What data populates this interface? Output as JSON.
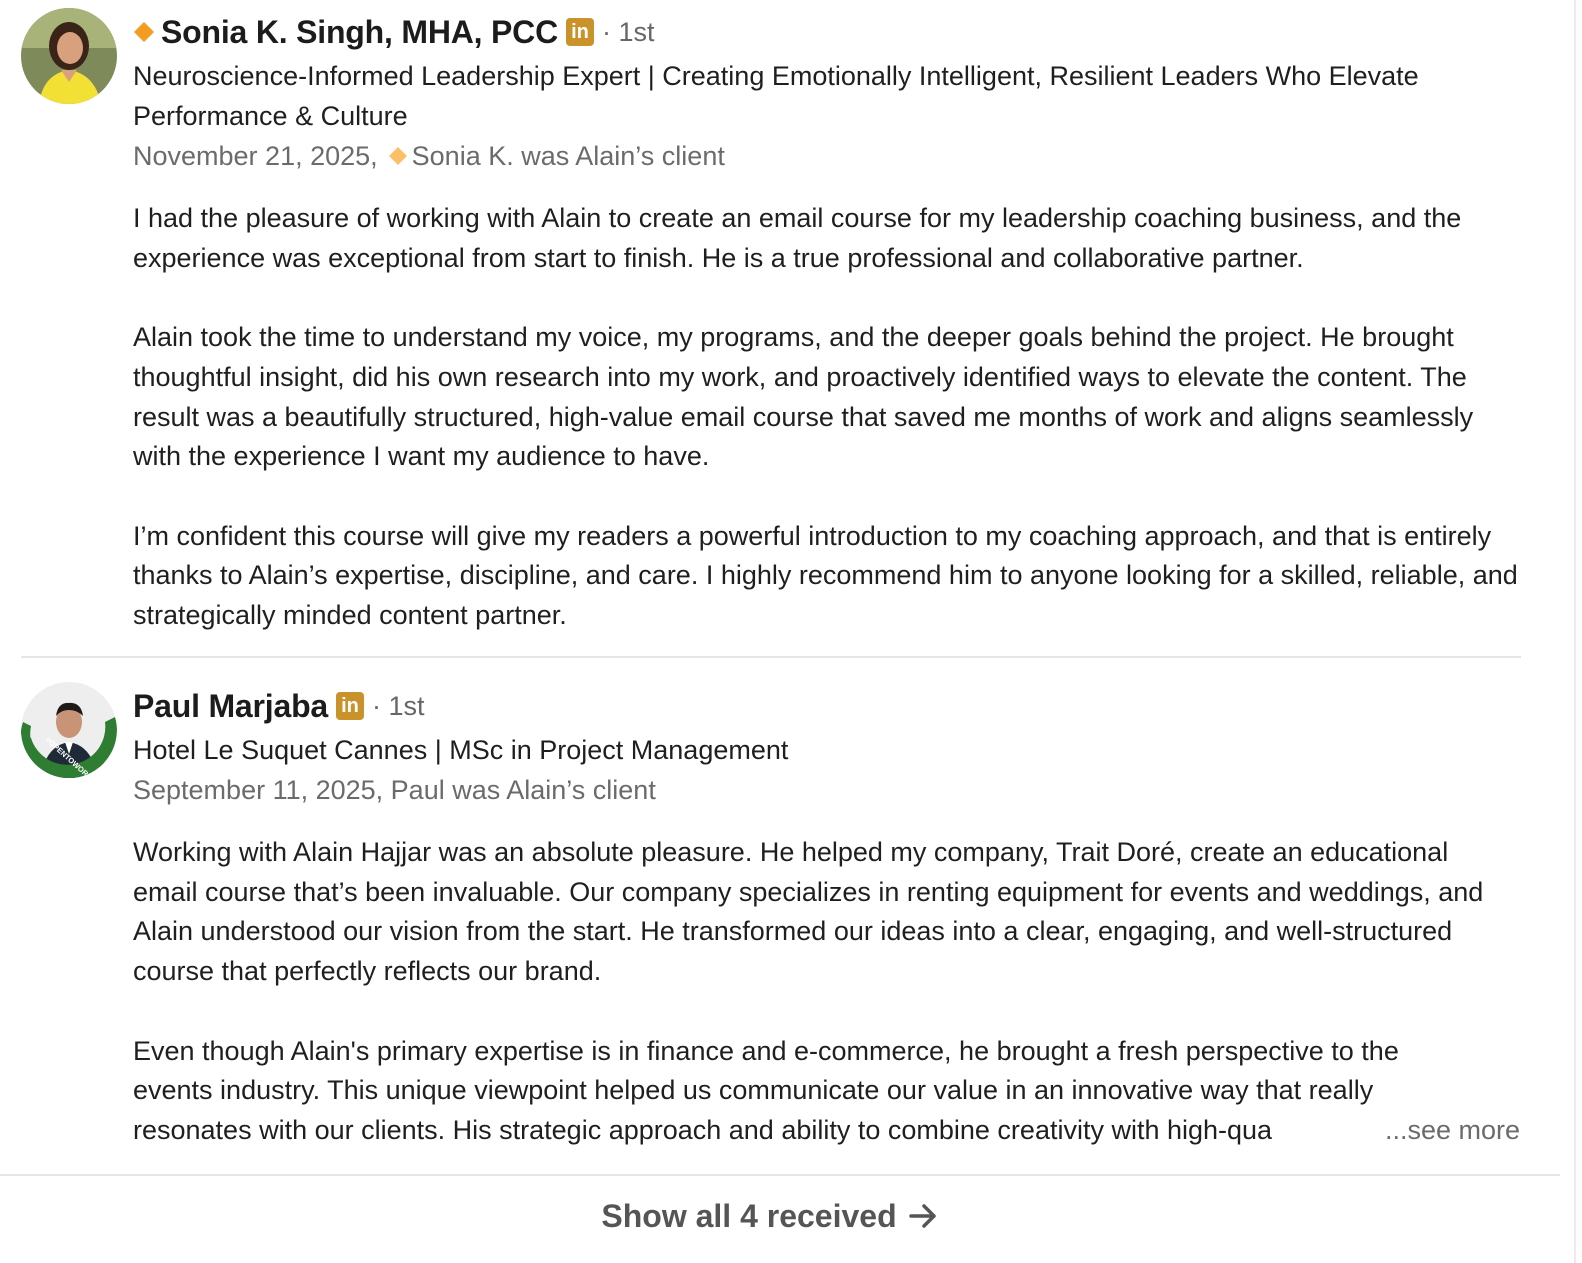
{
  "recommendations": [
    {
      "name": "Sonia K. Singh, MHA, PCC",
      "degree": "· 1st",
      "headline": "Neuroscience-Informed Leadership Expert | Creating Emotionally Intelligent, Resilient Leaders Who Elevate Performance & Culture",
      "date": "November 21, 2025,",
      "relationship": "Sonia K. was Alain’s client",
      "paragraphs": [
        "I had the pleasure of working with Alain to create an email course for my leadership coaching business, and the experience was exceptional from start to finish. He is a true professional and collaborative partner.",
        "Alain took the time to understand my voice, my programs, and the deeper goals behind the project. He brought thoughtful insight, did his own research into my work, and proactively identified ways to elevate the content. The result was a beautifully structured, high-value email course that saved me months of work and aligns seamlessly with the experience I want my audience to have.",
        "I’m confident this course will give my readers a powerful introduction to my coaching approach, and that is entirely thanks to Alain’s expertise, discipline, and care. I highly recommend him to anyone looking for a skilled, reliable, and strategically minded content partner."
      ],
      "badge_color": "#f59a23"
    },
    {
      "name": "Paul Marjaba",
      "degree": "· 1st",
      "headline": "Hotel Le Suquet Cannes | MSc in Project Management",
      "meta": "September 11, 2025, Paul was Alain’s client",
      "open_to_work": "#OPENTOWORK",
      "paragraphs": [
        "Working with Alain Hajjar was an absolute pleasure. He helped my company, Trait Doré, create an educational email course that’s been invaluable. Our company specializes in renting equipment for events and weddings, and Alain understood our vision from the start. He transformed our ideas into a clear, engaging, and well-structured course that perfectly reflects our brand."
      ],
      "truncated_paragraph_lines": [
        "Even though Alain's primary expertise is in finance and e-commerce, he brought a fresh perspective to the",
        "events industry. This unique viewpoint helped us communicate our value in an innovative way that really",
        "resonates with our clients. His strategic approach and ability to combine creativity with high-qua"
      ],
      "see_more": "...see more"
    }
  ],
  "linkedin_badge": "in",
  "show_all": "Show all 4 received",
  "icons": {
    "premium": "diamond-icon",
    "arrow": "arrow-right-icon",
    "linkedin": "linkedin-icon"
  },
  "colors": {
    "linkedin_badge": "#c9922a",
    "premium_diamond": "#f59a23",
    "open_to_work_green": "#2e7d32"
  }
}
